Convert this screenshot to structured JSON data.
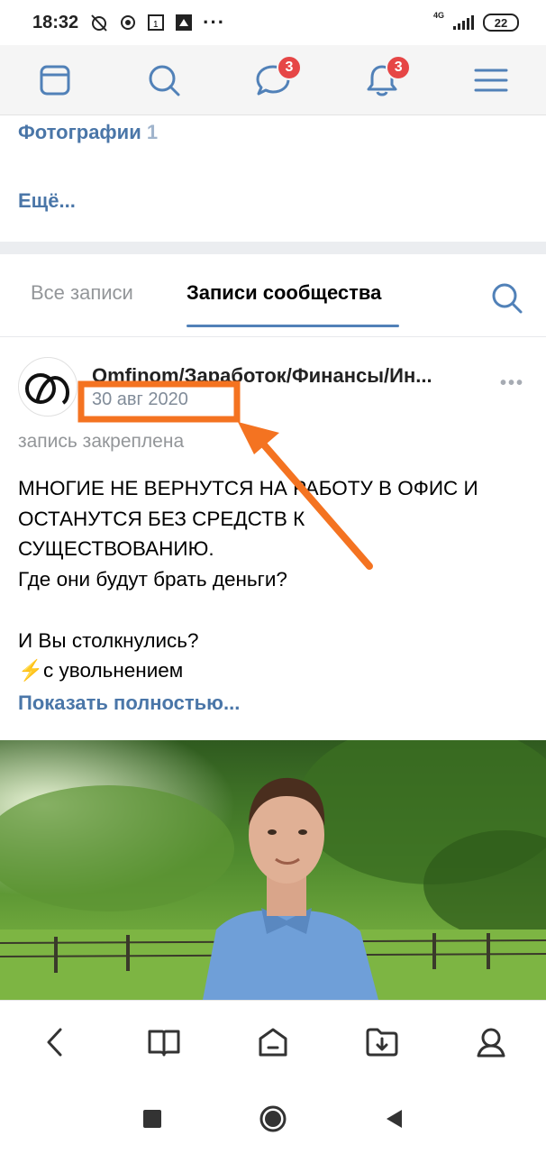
{
  "status_bar": {
    "time": "18:32",
    "network": "4G",
    "battery": "22"
  },
  "top_nav": {
    "items": [
      {
        "icon": "feed-icon",
        "badge": ""
      },
      {
        "icon": "search-icon",
        "badge": ""
      },
      {
        "icon": "messages-icon",
        "badge": "3"
      },
      {
        "icon": "notifications-icon",
        "badge": "3"
      },
      {
        "icon": "menu-icon",
        "badge": ""
      }
    ]
  },
  "profile": {
    "photos_label": "Фотографии",
    "photos_count": "1",
    "more_label": "Ещё..."
  },
  "tabs": {
    "all_posts": "Все записи",
    "community_posts": "Записи сообщества"
  },
  "post": {
    "author": "Omfinom/Заработок/Финансы/Ин...",
    "date": "30 авг 2020",
    "pinned": "запись закреплена",
    "text_lines": [
      "МНОГИЕ НЕ ВЕРНУТСЯ НА РАБОТУ В ОФИС И",
      "ОСТАНУТСЯ БЕЗ СРЕДСТВ К",
      "СУЩЕСТВОВАНИЮ.",
      "Где они будут брать деньги?",
      "",
      "И Вы столкнулись?",
      "⚡с увольнением"
    ],
    "show_full": "Показать полностью..."
  },
  "colors": {
    "link": "#4a76a8",
    "badge": "#e64646",
    "annotation": "#f47321",
    "tab_underline": "#5181b8"
  },
  "browser_bar": {
    "icons": [
      "back-icon",
      "bookmarks-icon",
      "home-icon",
      "downloads-icon",
      "profile-icon"
    ]
  },
  "system_nav": {
    "icons": [
      "recents-icon",
      "home-circle-icon",
      "back-triangle-icon"
    ]
  }
}
